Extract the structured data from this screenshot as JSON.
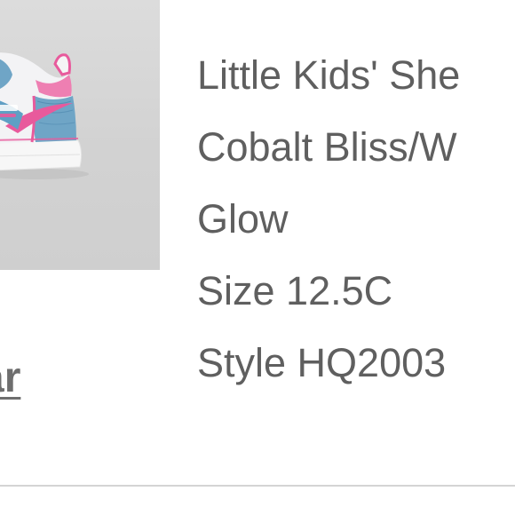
{
  "product": {
    "name": "Little Kids' She",
    "color_line1": "Cobalt Bliss/W",
    "color_line2": "Glow",
    "size": "Size 12.5C",
    "style": "Style HQ2003"
  },
  "actions": {
    "link_label": "ar"
  },
  "colors": {
    "text": "#5f5f5f",
    "image_background": "#d4d4d4",
    "divider": "#d4d4d4",
    "shoe_pink": "#e85a9c",
    "shoe_denim": "#5f9fc4"
  },
  "icons": {
    "product_image": "shoe-photo"
  }
}
